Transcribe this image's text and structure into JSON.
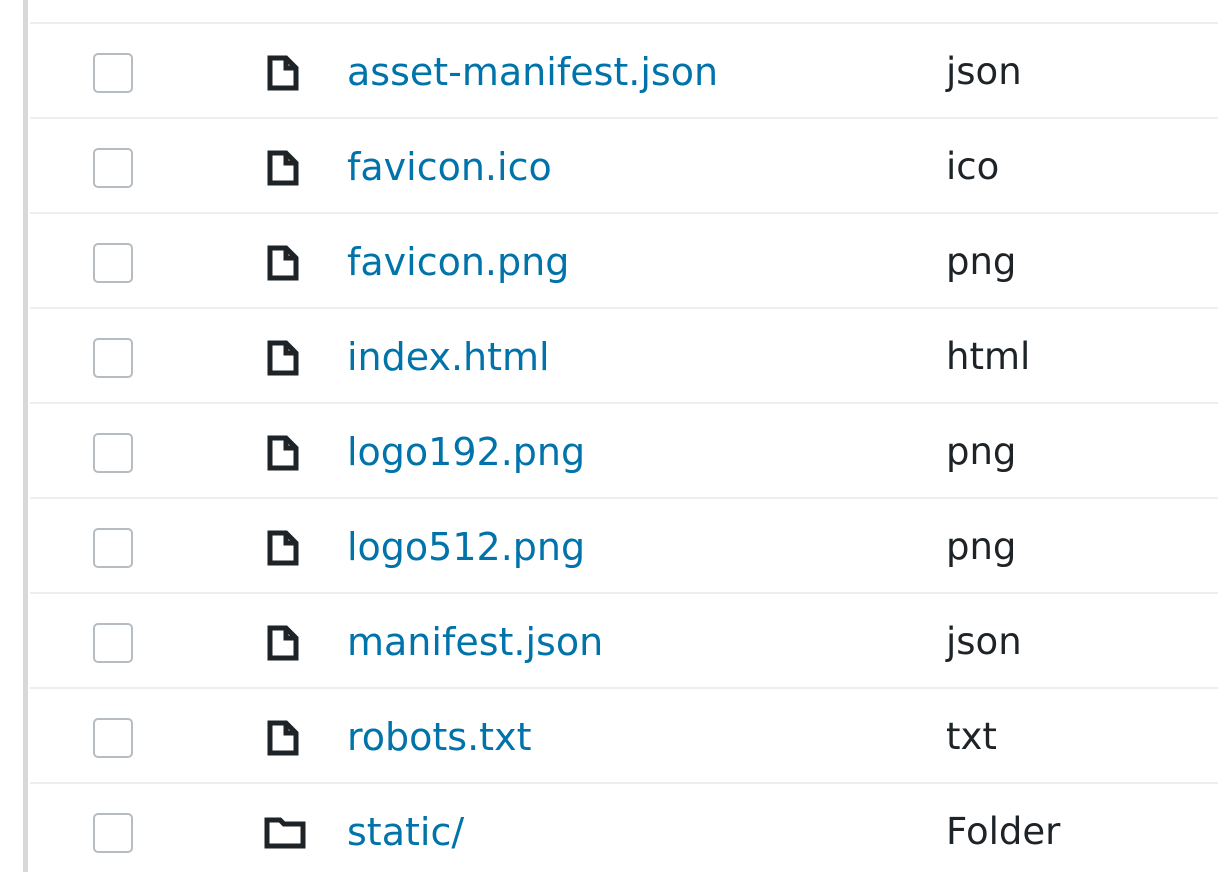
{
  "files": [
    {
      "name": "asset-manifest.json",
      "type": "json",
      "icon": "file-icon"
    },
    {
      "name": "favicon.ico",
      "type": "ico",
      "icon": "file-icon"
    },
    {
      "name": "favicon.png",
      "type": "png",
      "icon": "file-icon"
    },
    {
      "name": "index.html",
      "type": "html",
      "icon": "file-icon"
    },
    {
      "name": "logo192.png",
      "type": "png",
      "icon": "file-icon"
    },
    {
      "name": "logo512.png",
      "type": "png",
      "icon": "file-icon"
    },
    {
      "name": "manifest.json",
      "type": "json",
      "icon": "file-icon"
    },
    {
      "name": "robots.txt",
      "type": "txt",
      "icon": "file-icon"
    },
    {
      "name": "static/",
      "type": "Folder",
      "icon": "folder-icon"
    }
  ],
  "colors": {
    "link": "#0073aa",
    "text": "#1d2327",
    "row_divider": "#eceeef",
    "checkbox_border": "#b6bdc2",
    "icon": "#1d2327"
  }
}
